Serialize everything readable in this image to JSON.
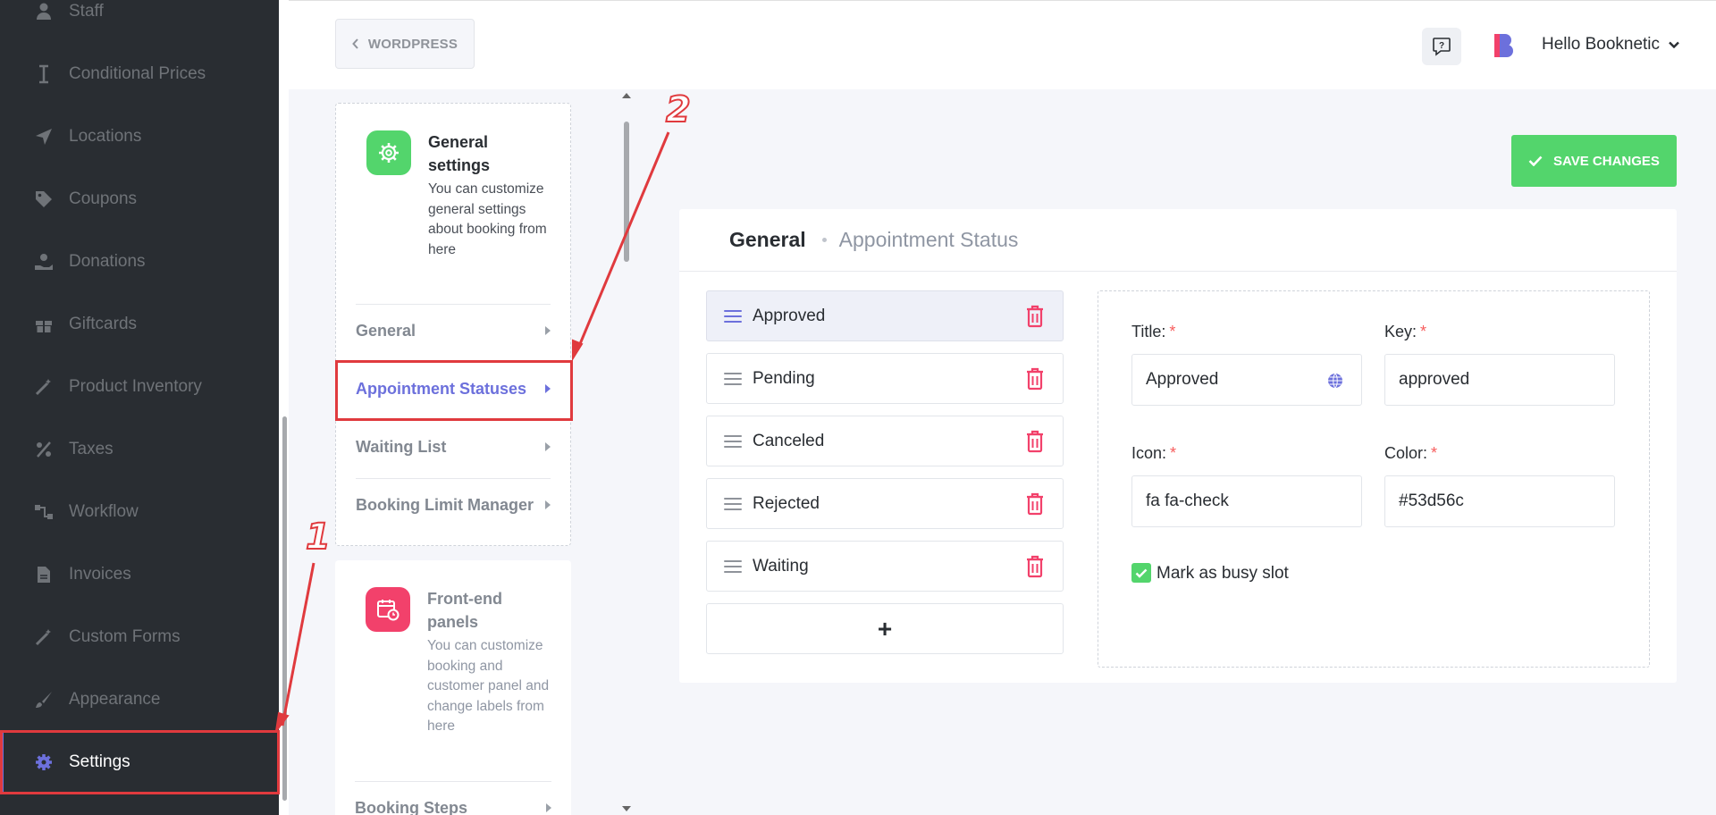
{
  "sidebar": {
    "items": [
      {
        "label": "Staff",
        "icon": "user-icon"
      },
      {
        "label": "Conditional Prices",
        "icon": "text-cursor-icon"
      },
      {
        "label": "Locations",
        "icon": "location-arrow-icon"
      },
      {
        "label": "Coupons",
        "icon": "tag-icon"
      },
      {
        "label": "Donations",
        "icon": "donation-hand-icon"
      },
      {
        "label": "Giftcards",
        "icon": "gift-icon"
      },
      {
        "label": "Product Inventory",
        "icon": "magic-wand-icon"
      },
      {
        "label": "Taxes",
        "icon": "percent-icon"
      },
      {
        "label": "Workflow",
        "icon": "workflow-icon"
      },
      {
        "label": "Invoices",
        "icon": "file-icon"
      },
      {
        "label": "Custom Forms",
        "icon": "magic-wand-icon"
      },
      {
        "label": "Appearance",
        "icon": "brush-icon"
      },
      {
        "label": "Settings",
        "icon": "gear-icon"
      }
    ],
    "active": "Settings"
  },
  "topbar": {
    "back_label": "WORDPRESS",
    "user_greeting": "Hello Booknetic"
  },
  "settings_nav": {
    "general_card": {
      "title": "General settings",
      "description": "You can customize general settings about booking from here",
      "links": [
        "General",
        "Appointment Statuses",
        "Waiting List",
        "Booking Limit Manager"
      ],
      "active_link": "Appointment Statuses"
    },
    "frontend_card": {
      "title": "Front-end panels",
      "description": "You can customize booking and customer panel and change labels from here",
      "links": [
        "Booking Steps"
      ]
    }
  },
  "actions": {
    "save_label": "SAVE CHANGES"
  },
  "content": {
    "breadcrumb_main": "General",
    "breadcrumb_sub": "Appointment Status",
    "statuses": [
      "Approved",
      "Pending",
      "Canceled",
      "Rejected",
      "Waiting"
    ],
    "selected_status": "Approved",
    "add_label": "+",
    "form": {
      "title_label": "Title:",
      "title_value": "Approved",
      "key_label": "Key:",
      "key_value": "approved",
      "icon_label": "Icon:",
      "icon_value": "fa fa-check",
      "color_label": "Color:",
      "color_value": "#53d56c",
      "busy_slot_label": "Mark as busy slot",
      "busy_slot_checked": true,
      "required_marker": "*"
    }
  },
  "annotations": {
    "step1": "1",
    "step2": "2"
  },
  "colors": {
    "accent": "#6c70dc",
    "success": "#53d56c",
    "danger": "#f2416b",
    "annotation": "#e03a3e",
    "sidebar_bg": "#292d32"
  }
}
